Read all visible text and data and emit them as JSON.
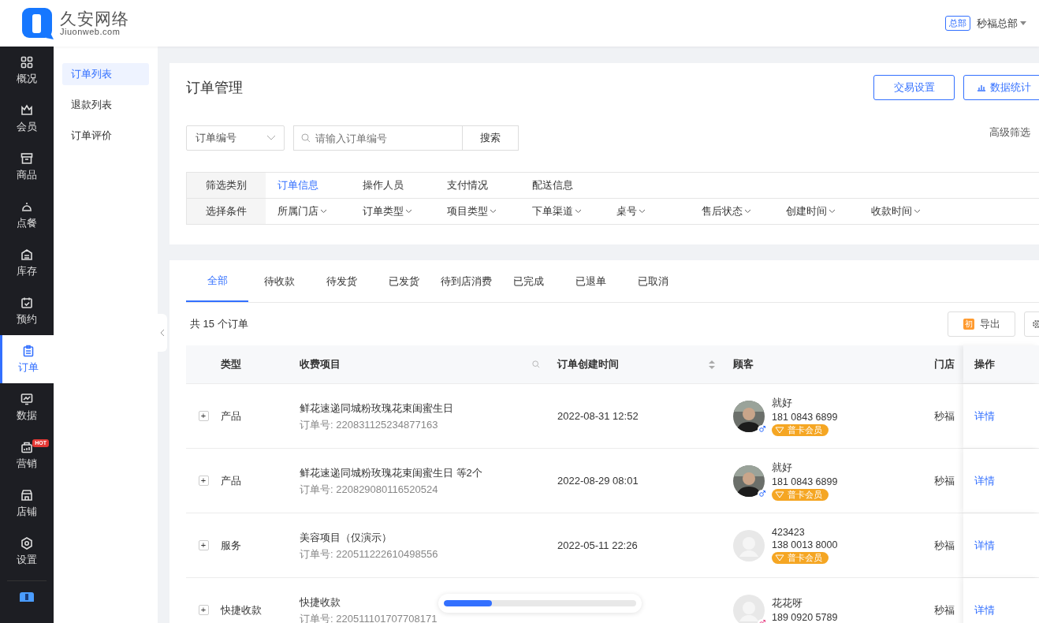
{
  "header": {
    "logo_name": "久安网络",
    "logo_domain": "Jiuonweb.com",
    "user_badge": "总部",
    "user_name": "秒福总部"
  },
  "nav": [
    {
      "label": "概况",
      "selected": false
    },
    {
      "label": "会员",
      "selected": false
    },
    {
      "label": "商品",
      "selected": false
    },
    {
      "label": "点餐",
      "selected": false
    },
    {
      "label": "库存",
      "selected": false
    },
    {
      "label": "预约",
      "selected": false
    },
    {
      "label": "订单",
      "selected": true
    },
    {
      "label": "数据",
      "selected": false
    },
    {
      "label": "营销",
      "selected": false,
      "badge": "HOT"
    },
    {
      "label": "店铺",
      "selected": false
    },
    {
      "label": "设置",
      "selected": false
    }
  ],
  "subnav": [
    {
      "label": "订单列表",
      "selected": true
    },
    {
      "label": "退款列表",
      "selected": false
    },
    {
      "label": "订单评价",
      "selected": false
    }
  ],
  "page": {
    "title": "订单管理",
    "buttons": [
      {
        "label": "交易设置",
        "kind": "plain"
      },
      {
        "label": "数据统计",
        "kind": "chart"
      }
    ],
    "search": {
      "field_select": "订单编号",
      "placeholder": "请输入订单编号",
      "button": "搜索",
      "advanced": "高级筛选"
    },
    "filter": {
      "category_label": "筛选类别",
      "categories": [
        {
          "label": "订单信息",
          "selected": true
        },
        {
          "label": "操作人员",
          "selected": false
        },
        {
          "label": "支付情况",
          "selected": false
        },
        {
          "label": "配送信息",
          "selected": false
        }
      ],
      "condition_label": "选择条件",
      "conditions": [
        "所属门店",
        "订单类型",
        "项目类型",
        "下单渠道",
        "桌号",
        "售后状态",
        "创建时间",
        "收款时间"
      ]
    }
  },
  "tabs": [
    {
      "label": "全部",
      "selected": true
    },
    {
      "label": "待收款",
      "selected": false
    },
    {
      "label": "待发货",
      "selected": false
    },
    {
      "label": "已发货",
      "selected": false
    },
    {
      "label": "待到店消费",
      "selected": false
    },
    {
      "label": "已完成",
      "selected": false
    },
    {
      "label": "已退单",
      "selected": false
    },
    {
      "label": "已取消",
      "selected": false
    }
  ],
  "summary": "共 15 个订单",
  "export_button": "导出",
  "export_icon": "初",
  "table": {
    "columns": [
      "类型",
      "收费项目",
      "订单创建时间",
      "顾客",
      "门店",
      "操作"
    ],
    "rows": [
      {
        "expand": "+",
        "type": "产品",
        "item": "鲜花速递同城粉玫瑰花束闺蜜生日",
        "order_no": "订单号: 220831125234877163",
        "time": "2022-08-31 12:52",
        "male": true,
        "female": false,
        "customer": "就好",
        "phone": "181 0843 6899",
        "member": "普卡会员",
        "store": "秒福",
        "action": "详情"
      },
      {
        "expand": "+",
        "type": "产品",
        "item": "鲜花速递同城粉玫瑰花束闺蜜生日 等2个",
        "order_no": "订单号: 220829080116520524",
        "time": "2022-08-29 08:01",
        "male": true,
        "female": false,
        "customer": "就好",
        "phone": "181 0843 6899",
        "member": "普卡会员",
        "store": "秒福",
        "action": "详情"
      },
      {
        "expand": "+",
        "type": "服务",
        "item": "美容项目（仅演示）",
        "order_no": "订单号: 220511222610498556",
        "time": "2022-05-11 22:26",
        "kind": "default",
        "male": false,
        "female": false,
        "customer": "423423",
        "phone": "138 0013 8000",
        "member": "普卡会员",
        "store": "秒福",
        "action": "详情"
      },
      {
        "expand": "+",
        "type": "快捷收款",
        "item": "快捷收款",
        "order_no": "订单号: 220511101707708171",
        "kind": "default",
        "male": false,
        "female": true,
        "customer": "花花呀",
        "phone": "189 0920 5789",
        "store": "秒福",
        "action": "详情"
      }
    ]
  },
  "loading": {
    "level": 0.25
  }
}
